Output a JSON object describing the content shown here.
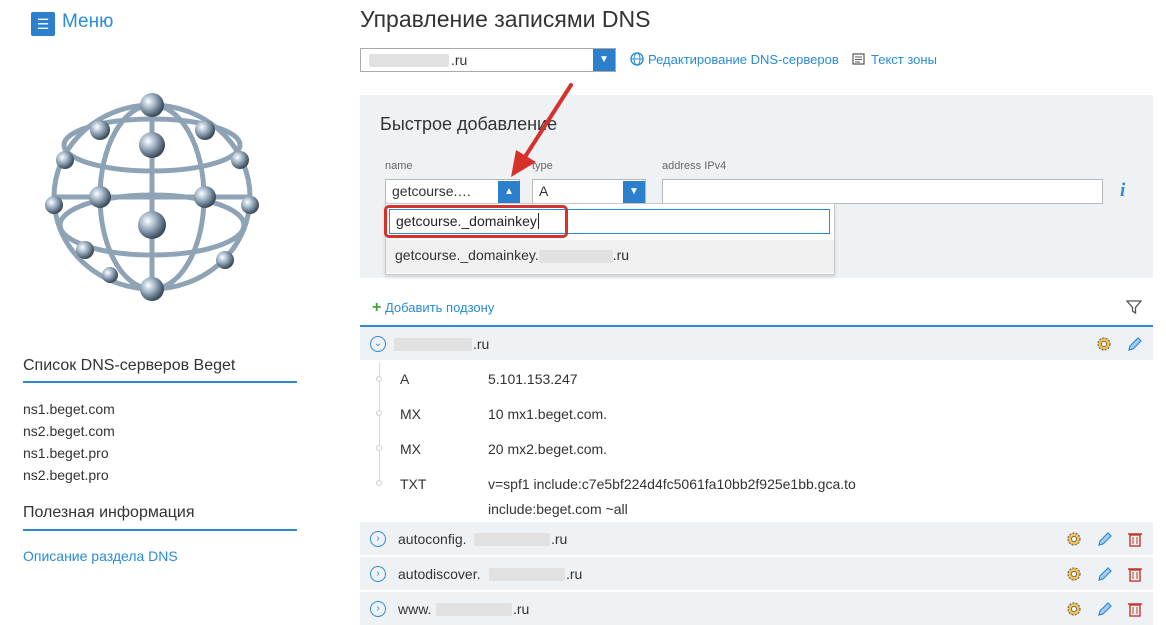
{
  "sidebar": {
    "menu_icon": "hamburger-icon",
    "menu_label": "Меню",
    "logo": "globe-network-logo",
    "ns_heading": "Список DNS-серверов Beget",
    "ns_servers": [
      "ns1.beget.com",
      "ns2.beget.com",
      "ns1.beget.pro",
      "ns2.beget.pro"
    ],
    "info_heading": "Полезная информация",
    "info_link": "Описание раздела DNS"
  },
  "header": {
    "title": "Управление записями DNS",
    "domain_suffix": ".ru",
    "edit_dns_link": "Редактирование DNS-серверов",
    "zone_text_link": "Текст зоны"
  },
  "quick_add": {
    "title": "Быстрое добавление",
    "name_label": "name",
    "name_value": "getcourse.…",
    "type_label": "type",
    "type_value": "A",
    "address_label": "address IPv4",
    "address_value": "",
    "dropdown_input": "getcourse._domainkey",
    "dropdown_option_prefix": "getcourse._domainkey.",
    "dropdown_option_suffix": ".ru",
    "info_icon": "i"
  },
  "add_subzone": "Добавить подзону",
  "zone": {
    "suffix": ".ru",
    "records": [
      {
        "type": "A",
        "value": "5.101.153.247"
      },
      {
        "type": "MX",
        "value": "10 mx1.beget.com."
      },
      {
        "type": "MX",
        "value": "20 mx2.beget.com."
      },
      {
        "type": "TXT",
        "value": "v=spf1 include:c7e5bf224d4fc5061fa10bb2f925e1bb.gca.to",
        "value2": "include:beget.com ~all"
      }
    ]
  },
  "subzones": [
    {
      "prefix": "autoconfig.",
      "suffix": ".ru"
    },
    {
      "prefix": "autodiscover.",
      "suffix": ".ru"
    },
    {
      "prefix": "www.",
      "suffix": ".ru"
    }
  ],
  "colors": {
    "accent": "#2f8ad6",
    "link": "#2a8bd8",
    "highlight": "#d7312c",
    "panel": "#eef2f5"
  }
}
